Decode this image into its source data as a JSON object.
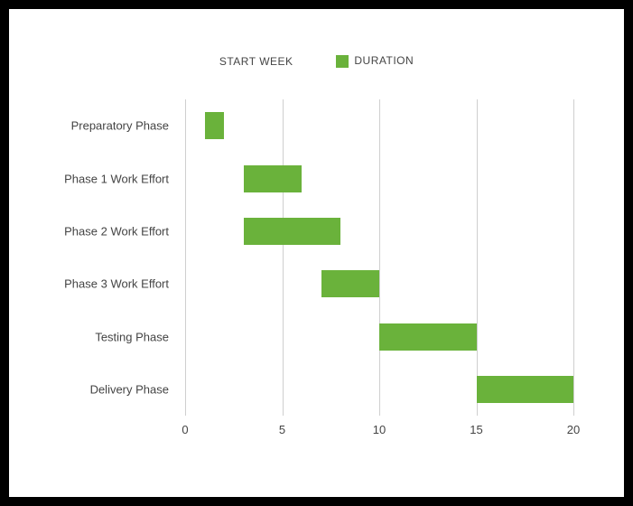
{
  "legend": {
    "start_week": "START WEEK",
    "duration": "DURATION"
  },
  "chart_data": {
    "type": "bar",
    "orientation": "horizontal",
    "stacked_gantt": true,
    "categories": [
      "Preparatory Phase",
      "Phase 1 Work Effort",
      "Phase 2 Work Effort",
      "Phase 3 Work Effort",
      "Testing Phase",
      "Delivery Phase"
    ],
    "series": [
      {
        "name": "START WEEK",
        "values": [
          1,
          3,
          3,
          7,
          10,
          15
        ],
        "color": "transparent"
      },
      {
        "name": "DURATION",
        "values": [
          1,
          3,
          5,
          3,
          5,
          5
        ],
        "color": "#6ab23b"
      }
    ],
    "xlabel": "",
    "ylabel": "",
    "xlim": [
      0,
      20
    ],
    "xticks": [
      0,
      5,
      10,
      15,
      20
    ],
    "grid": true,
    "legend_position": "top"
  }
}
